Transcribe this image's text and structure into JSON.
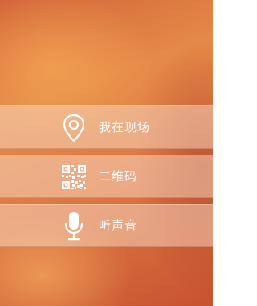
{
  "menu": {
    "items": [
      {
        "label": "我在现场",
        "icon": "location-pin-icon"
      },
      {
        "label": "二维码",
        "icon": "qr-code-icon"
      },
      {
        "label": "听声音",
        "icon": "microphone-icon"
      }
    ]
  }
}
